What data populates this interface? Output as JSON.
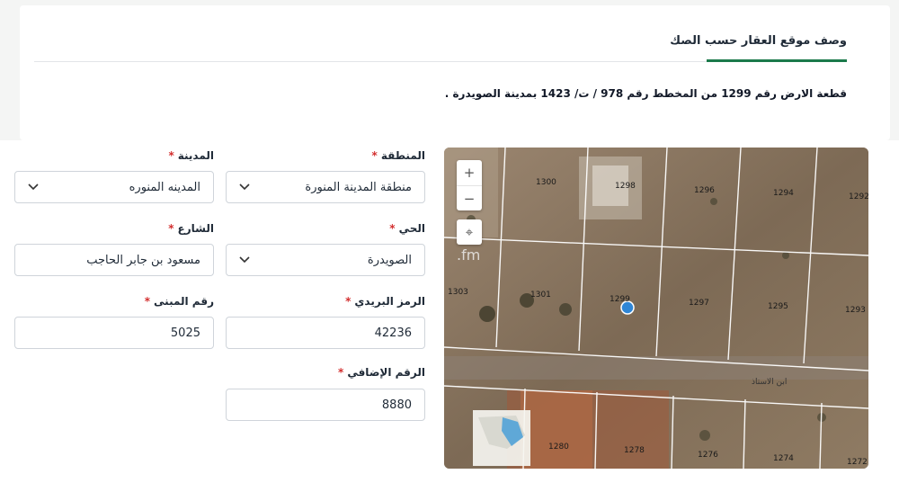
{
  "section": {
    "tab_title": "وصف موقع العقار حسب الصك",
    "description": "قطعة الارض رقم 1299 من المخطط رقم 978 / ت/ 1423 بمدينة الصويدرة ."
  },
  "form": {
    "region": {
      "label": "المنطقة",
      "value": "منطقة المدينة المنورة"
    },
    "city": {
      "label": "المدينة",
      "value": "المدينه المنوره"
    },
    "district": {
      "label": "الحي",
      "value": "الصويدرة"
    },
    "street": {
      "label": "الشارع",
      "value": "مسعود بن جابر الحاجب"
    },
    "postal_code": {
      "label": "الرمز البريدي",
      "value": "42236"
    },
    "building_no": {
      "label": "رقم المبنى",
      "value": "5025"
    },
    "additional_no": {
      "label": "الرقم الإضافي",
      "value": "8880"
    },
    "required_mark": "*"
  },
  "map": {
    "zoom_in": "+",
    "zoom_out": "−",
    "locate": "⌖",
    "watermark": ".fm",
    "road_name": "ابن الاستاذ",
    "plots": [
      "1300",
      "1298",
      "1296",
      "1294",
      "1292",
      "1303",
      "1301",
      "1299",
      "1297",
      "1295",
      "1293",
      "1280",
      "1278",
      "1276",
      "1274",
      "1272"
    ],
    "colors": {
      "marker": "#2f86d6",
      "ground": "#8b7660"
    }
  }
}
